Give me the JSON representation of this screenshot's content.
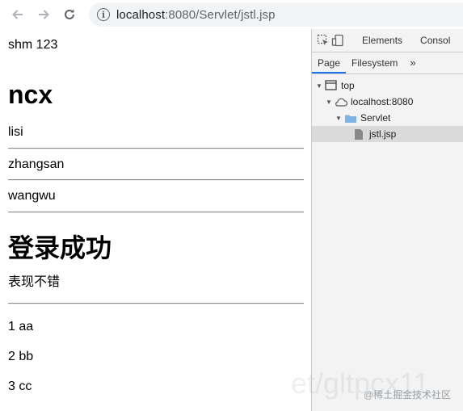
{
  "browser": {
    "url_host": "localhost",
    "url_rest": ":8080/Servlet/jstl.jsp"
  },
  "page": {
    "line1": "shm 123",
    "heading1": "ncx",
    "names": [
      "lisi",
      "zhangsan",
      "wangwu"
    ],
    "heading2": "登录成功",
    "remark": "表现不错",
    "items": [
      "1 aa",
      "2 bb",
      "3 cc"
    ]
  },
  "devtools": {
    "tabs": [
      "Elements",
      "Consol"
    ],
    "subtabs": [
      "Page",
      "Filesystem"
    ],
    "more": "»",
    "tree": {
      "top": "top",
      "host": "localhost:8080",
      "folder": "Servlet",
      "file": "jstl.jsp"
    }
  },
  "watermark": {
    "faded": "et/gltpcx11",
    "site": "@稀土掘金技术社区"
  }
}
